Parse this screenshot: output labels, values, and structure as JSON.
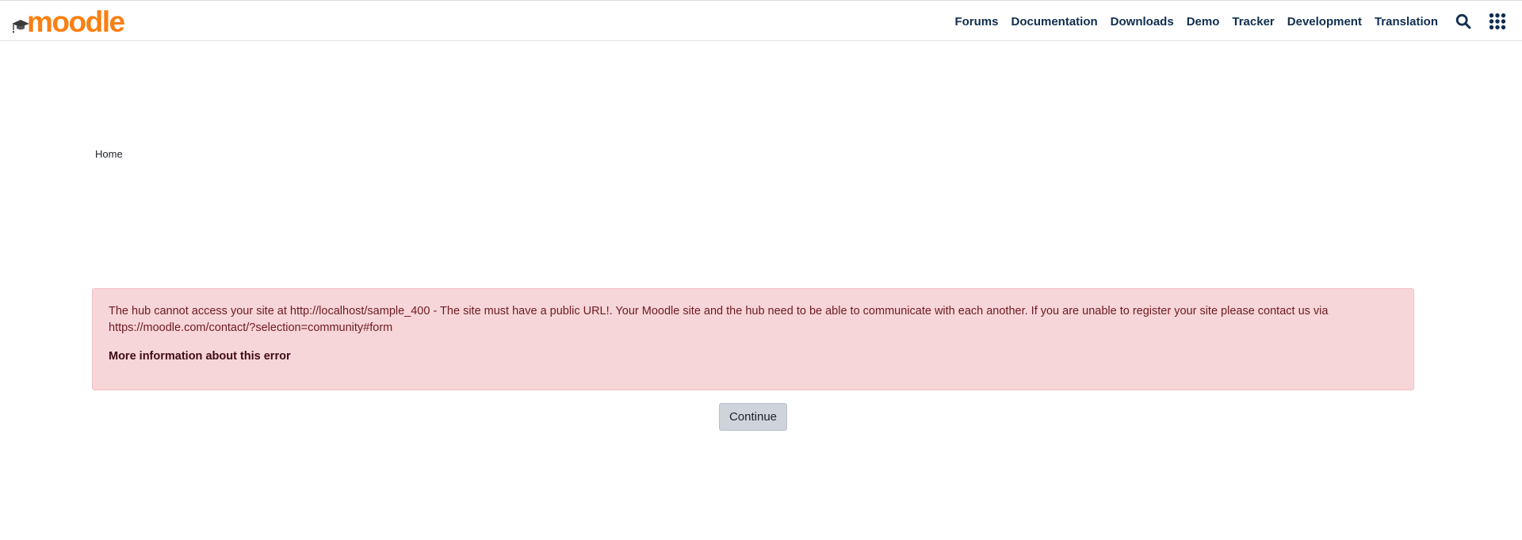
{
  "header": {
    "logo_text": "moodle",
    "nav": [
      {
        "label": "Forums"
      },
      {
        "label": "Documentation"
      },
      {
        "label": "Downloads"
      },
      {
        "label": "Demo"
      },
      {
        "label": "Tracker"
      },
      {
        "label": "Development"
      },
      {
        "label": "Translation"
      }
    ],
    "icons": [
      "search-icon",
      "apps-grid-icon"
    ]
  },
  "breadcrumb": {
    "home": "Home"
  },
  "alert": {
    "message": "The hub cannot access your site at http://localhost/sample_400 - The site must have a public URL!. Your Moodle site and the hub need to be able to communicate with each another. If you are unable to register your site please contact us via https://moodle.com/contact/?selection=community#form",
    "more_info": "More information about this error"
  },
  "actions": {
    "continue_label": "Continue"
  },
  "colors": {
    "brand_orange": "#f98012",
    "nav_text": "#0f2e4f",
    "alert_bg": "#f7d6d9",
    "alert_text": "#6e1a20",
    "button_bg": "#ced4da"
  }
}
